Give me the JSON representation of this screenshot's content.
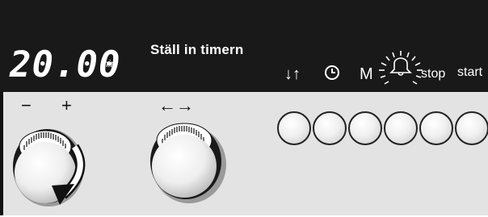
{
  "display": {
    "time_value": "20.00",
    "time_unit": "min",
    "instruction": "Ställ in timern"
  },
  "function_symbols": {
    "updown": "↓↑",
    "clock_icon": "clock-icon",
    "memory": "M",
    "bell_icon": "bell-icon",
    "stop": "stop",
    "start": "start"
  },
  "knobs": {
    "left": {
      "minus": "−",
      "plus": "+",
      "icon": "rotate-clockwise-arrow-icon"
    },
    "right": {
      "arrows": "←→"
    }
  },
  "buttons": [
    {
      "name": "round-button-1"
    },
    {
      "name": "round-button-2"
    },
    {
      "name": "round-button-3"
    },
    {
      "name": "round-button-4"
    },
    {
      "name": "round-button-5"
    },
    {
      "name": "round-button-6"
    }
  ],
  "colors": {
    "display_bg": "#191919",
    "panel_bg": "#e3e3e3",
    "text_on_display": "#ffffff",
    "arrow": "#111111"
  }
}
